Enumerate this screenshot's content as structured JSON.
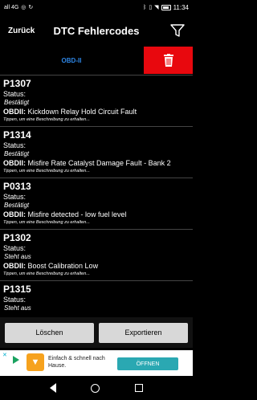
{
  "statusbar": {
    "signal": "all 4G",
    "time": "11:34"
  },
  "appbar": {
    "back_label": "Zurück",
    "title": "DTC Fehlercodes"
  },
  "tabs": {
    "obd_label": "OBD-II"
  },
  "dtc_list": [
    {
      "code": "P1307",
      "status_label": "Status:",
      "status": "Bestätigt",
      "prefix": "OBDII:",
      "description": "Kickdown Relay Hold Circuit Fault",
      "hint": "Tippen, um eine Beschreibung zu erhalten..."
    },
    {
      "code": "P1314",
      "status_label": "Status:",
      "status": "Bestätigt",
      "prefix": "OBDII:",
      "description": "Misfire Rate Catalyst Damage Fault - Bank 2",
      "hint": "Tippen, um eine Beschreibung zu erhalten..."
    },
    {
      "code": "P0313",
      "status_label": "Status:",
      "status": "Bestätigt",
      "prefix": "OBDII:",
      "description": "Misfire detected - low fuel level",
      "hint": "Tippen, um eine Beschreibung zu erhalten..."
    },
    {
      "code": "P1302",
      "status_label": "Status:",
      "status": "Steht aus",
      "prefix": "OBDII:",
      "description": "Boost Calibration Low",
      "hint": "Tippen, um eine Beschreibung zu erhalten..."
    },
    {
      "code": "P1315",
      "status_label": "Status:",
      "status": "Steht aus",
      "prefix": "",
      "description": "",
      "hint": ""
    }
  ],
  "buttons": {
    "delete_label": "Löschen",
    "export_label": "Exportieren"
  },
  "ad": {
    "text": "Einfach & schnell nach Hause.",
    "cta": "ÖFFNEN"
  },
  "colors": {
    "accent_blue": "#2e86e6",
    "delete_red": "#e8080e"
  }
}
